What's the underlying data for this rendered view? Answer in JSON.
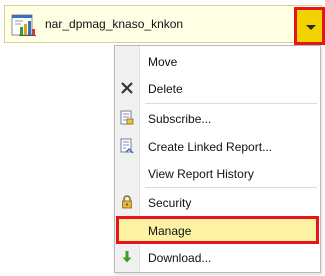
{
  "report": {
    "name": "nar_dpmag_knaso_knkon",
    "icon": "report-chart-icon"
  },
  "dropdown": {
    "icon": "chevron-down-icon",
    "highlight_color": "#e8141b",
    "button_color": "#f2d300"
  },
  "menu": {
    "items": [
      {
        "label": "Move",
        "icon": "none"
      },
      {
        "label": "Delete",
        "icon": "close-icon"
      },
      {
        "label": "Subscribe...",
        "icon": "subscribe-icon"
      },
      {
        "label": "Create Linked Report...",
        "icon": "linked-report-icon"
      },
      {
        "label": "View Report History",
        "icon": "none"
      },
      {
        "label": "Security",
        "icon": "lock-icon"
      },
      {
        "label": "Manage",
        "icon": "none",
        "highlighted": true
      },
      {
        "label": "Download...",
        "icon": "download-arrow-icon"
      }
    ],
    "highlight_background": "#fbf3a3"
  }
}
